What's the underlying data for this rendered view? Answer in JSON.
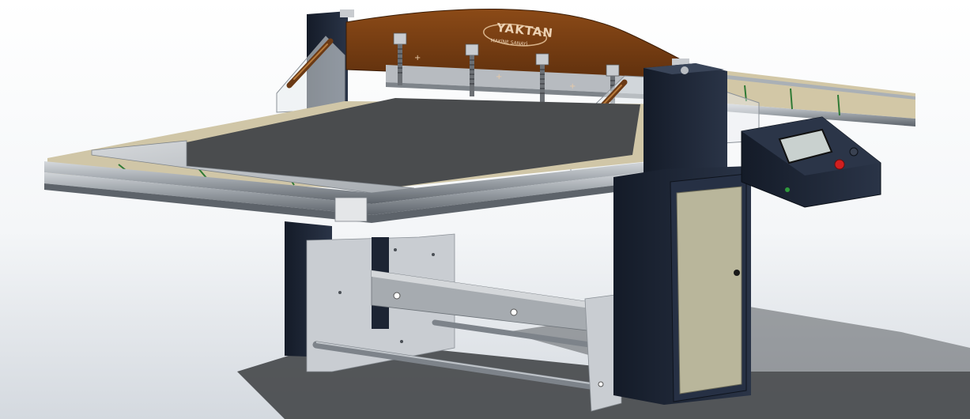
{
  "logo": {
    "brand": "YAKTAN",
    "tagline": "MAKİNE SANAYİ"
  },
  "colors": {
    "background_top": "#ffffff",
    "background_bottom": "#d8dde3",
    "header_arch": "#7a3e12",
    "frame_dark": "#1c2433",
    "frame_light": "#c9cdd2",
    "table_sheet": "#4a4c4e",
    "table_insert": "#c6bc9e",
    "panel_door": "#b9b69b",
    "screen": "#c9d1cf",
    "emergency_button": "#d21f1f"
  },
  "icons": {
    "machine": "industrial-sheet-cutter-3d-render",
    "control_panel": "touch-screen-control-panel",
    "emergency_stop": "emergency-stop-button"
  }
}
